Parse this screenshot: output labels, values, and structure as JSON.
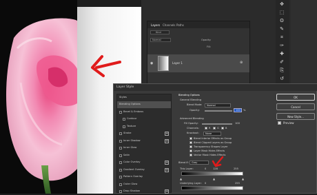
{
  "layers_panel": {
    "tabs": [
      "Layers",
      "Channels",
      "Paths"
    ],
    "search_placeholder": "Kind",
    "mode_label": "Normal",
    "opacity_label": "Opacity:",
    "fill_label": "Fill:",
    "layer_name": "Layer 1"
  },
  "toolbar_icons": [
    "move-icon",
    "marquee-icon",
    "lasso-icon",
    "quick-select-icon",
    "crop-icon",
    "eyedropper-icon",
    "heal-icon",
    "brush-icon",
    "stamp-icon",
    "history-brush-icon",
    "eraser-icon",
    "gradient-icon",
    "blur-icon",
    "dodge-icon",
    "pen-icon",
    "type-icon",
    "path-select-icon",
    "shape-icon",
    "hand-icon",
    "zoom-icon"
  ],
  "dialog": {
    "title": "Layer Style",
    "styles_header": "Styles",
    "styles": [
      {
        "label": "Blending Options",
        "checkbox": false,
        "plus": false,
        "selected": true
      },
      {
        "label": "Bevel & Emboss",
        "checkbox": true,
        "plus": false
      },
      {
        "label": "Contour",
        "checkbox": true,
        "plus": false,
        "indent": true
      },
      {
        "label": "Texture",
        "checkbox": true,
        "plus": false,
        "indent": true
      },
      {
        "label": "Stroke",
        "checkbox": true,
        "plus": true
      },
      {
        "label": "Inner Shadow",
        "checkbox": true,
        "plus": true
      },
      {
        "label": "Inner Glow",
        "checkbox": true,
        "plus": false
      },
      {
        "label": "Satin",
        "checkbox": true,
        "plus": false
      },
      {
        "label": "Color Overlay",
        "checkbox": true,
        "plus": true
      },
      {
        "label": "Gradient Overlay",
        "checkbox": true,
        "plus": true
      },
      {
        "label": "Pattern Overlay",
        "checkbox": true,
        "plus": false
      },
      {
        "label": "Outer Glow",
        "checkbox": true,
        "plus": false
      },
      {
        "label": "Drop Shadow",
        "checkbox": true,
        "plus": true
      }
    ],
    "blending": {
      "section_title": "Blending Options",
      "general_title": "General Blending",
      "blend_mode_label": "Blend Mode:",
      "blend_mode_value": "Normal",
      "opacity_label": "Opacity:",
      "opacity_value": "100",
      "opacity_unit": "%",
      "advanced_title": "Advanced Blending",
      "fill_opacity_label": "Fill Opacity:",
      "fill_opacity_value": "100",
      "channels_label": "Channels:",
      "channels": [
        "R",
        "G",
        "B"
      ],
      "knockout_label": "Knockout:",
      "knockout_value": "None",
      "options": [
        "Blend Interior Effects as Group",
        "Blend Clipped Layers as Group",
        "Transparency Shapes Layer",
        "Layer Mask Hides Effects",
        "Vector Mask Hides Effects"
      ],
      "blend_if_label": "Blend If:",
      "blend_if_value": "Gray",
      "this_layer_label": "This Layer:",
      "this_layer_values": [
        "0",
        "128",
        "255"
      ],
      "underlying_label": "Underlying Layer:",
      "underlying_values": [
        "0",
        "255"
      ]
    },
    "buttons": {
      "ok": "OK",
      "cancel": "Cancel",
      "new_style": "New Style..."
    },
    "preview_label": "Preview"
  },
  "colors": {
    "annotation_red": "#e01b1b",
    "dialog_bg": "#3a3a3a"
  }
}
